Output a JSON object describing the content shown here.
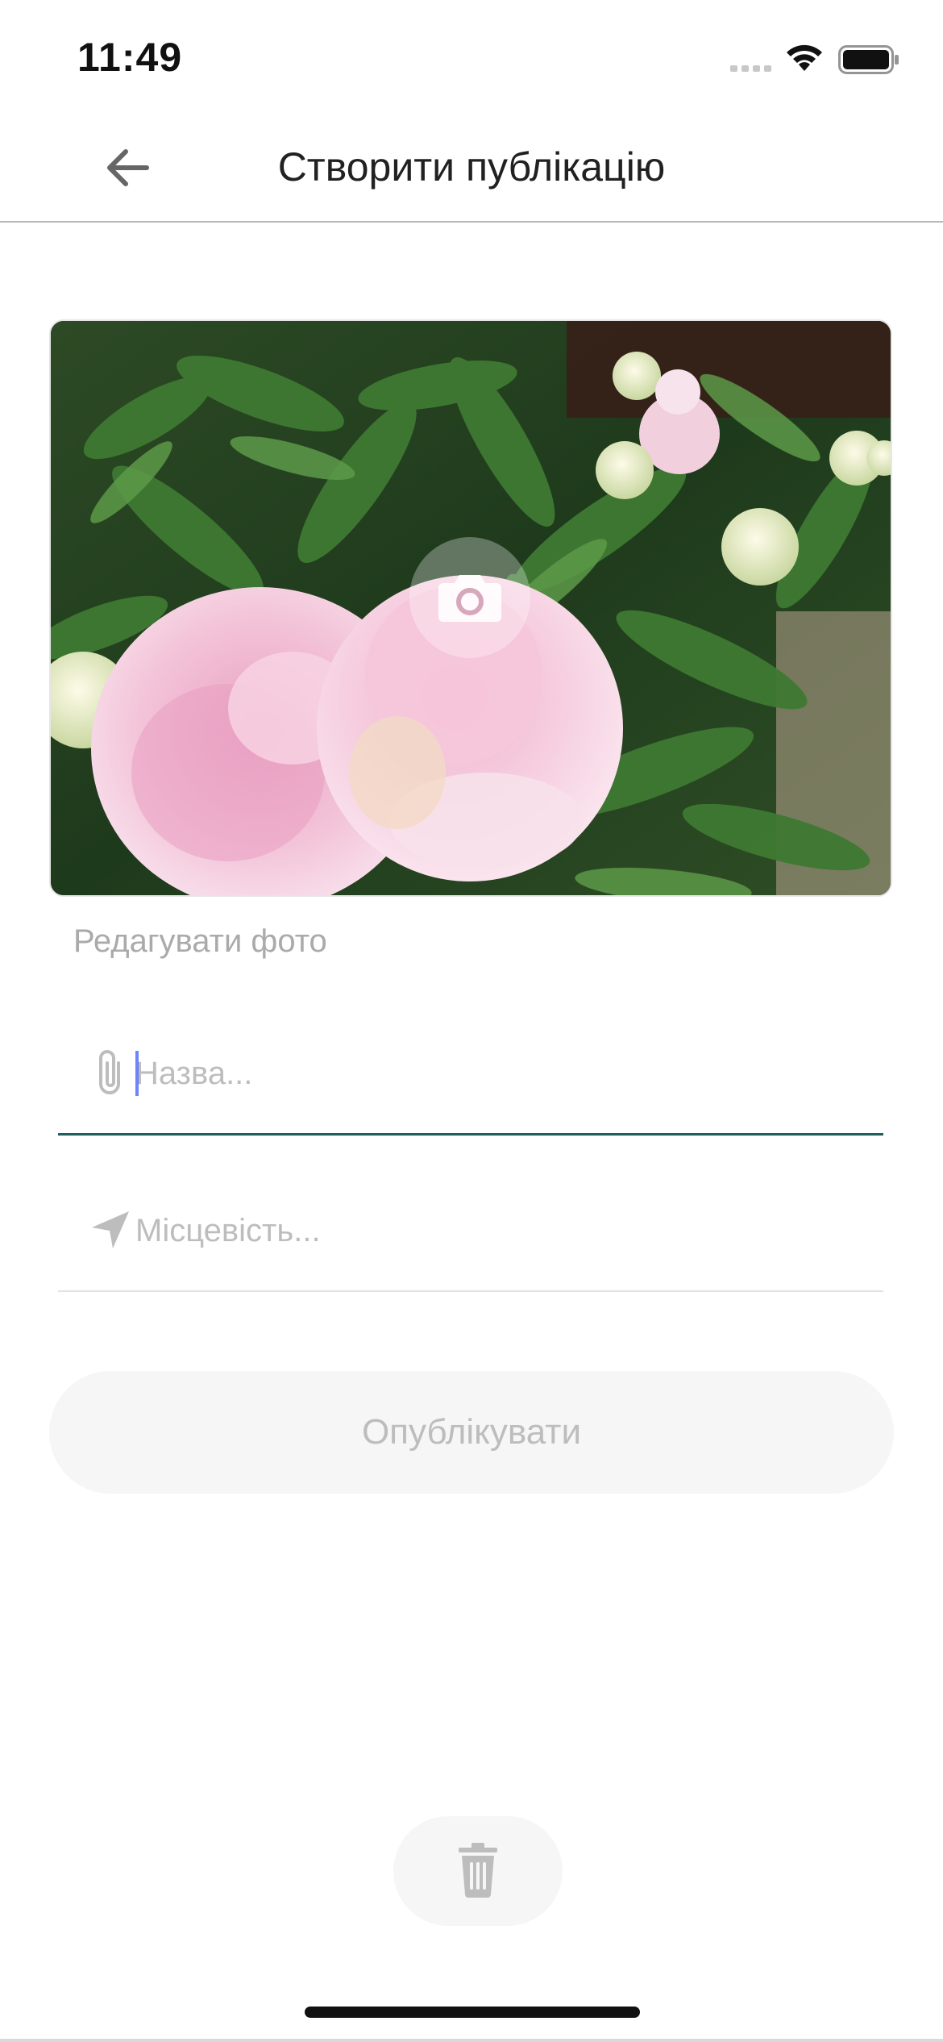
{
  "status_bar": {
    "time": "11:49",
    "icons": [
      "signal-icon",
      "wifi-icon",
      "battery-icon"
    ]
  },
  "header": {
    "back_icon": "arrow-left-icon",
    "title": "Створити публікацію"
  },
  "photo": {
    "subject": "pink peonies",
    "camera_icon": "camera-icon",
    "edit_label": "Редагувати фото"
  },
  "form": {
    "title": {
      "icon": "paperclip-icon",
      "placeholder": "Назва...",
      "value": "",
      "focused": true
    },
    "location": {
      "icon": "location-arrow-icon",
      "placeholder": "Місцевість...",
      "value": ""
    },
    "publish_label": "Опублікувати"
  },
  "footer": {
    "delete_icon": "trash-icon"
  },
  "colors": {
    "accent_underline": "#1e5e5c",
    "placeholder": "#bdbdbd",
    "disabled_button_bg": "#f6f6f6",
    "disabled_button_text": "#bdbdbd"
  }
}
